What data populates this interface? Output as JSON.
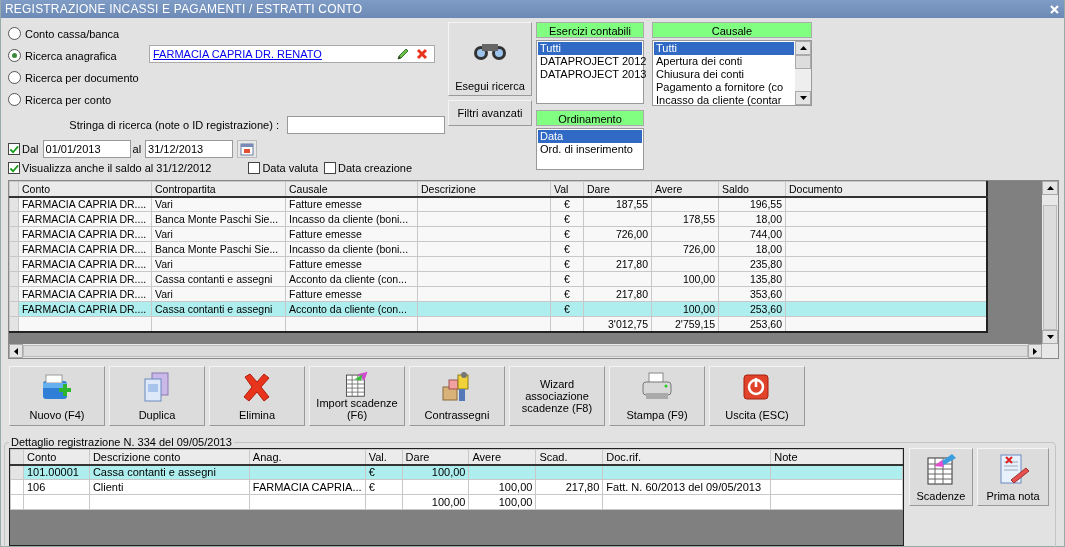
{
  "window": {
    "title": "REGISTRAZIONE INCASSI E PAGAMENTI / ESTRATTI CONTO"
  },
  "search_modes": [
    {
      "label": "Conto cassa/banca",
      "selected": false
    },
    {
      "label": "Ricerca anagrafica",
      "selected": true
    },
    {
      "label": "Ricerca per documento",
      "selected": false
    },
    {
      "label": "Ricerca per conto",
      "selected": false
    }
  ],
  "partner_field": {
    "value": "FARMACIA CAPRIA DR. RENATO"
  },
  "search_string": {
    "label": "Stringa di ricerca (note o ID registrazione) :"
  },
  "date_filter": {
    "checked": true,
    "from_label": "Dal",
    "from": "01/01/2013",
    "to_label": "al",
    "to": "31/12/2013"
  },
  "options": [
    {
      "label": "Visualizza anche il saldo al 31/12/2012",
      "checked": true
    },
    {
      "label": "Data valuta",
      "checked": false
    },
    {
      "label": "Data creazione",
      "checked": false
    }
  ],
  "search_buttons": [
    {
      "label": "Esegui ricerca",
      "kind": "search"
    },
    {
      "label": "Filtri avanzati",
      "kind": "plain"
    }
  ],
  "lists": [
    {
      "title": "Esercizi contabili",
      "items": [
        {
          "label": "Tutti",
          "selected": true
        },
        {
          "label": "DATAPROJECT 2012",
          "selected": false
        },
        {
          "label": "DATAPROJECT 2013",
          "selected": false
        }
      ]
    },
    {
      "title": "Ordinamento",
      "items": [
        {
          "label": "Data",
          "selected": true
        },
        {
          "label": "Ord. di inserimento",
          "selected": false
        }
      ]
    },
    {
      "title": "Causale",
      "items": [
        {
          "label": "Tutti",
          "selected": true
        },
        {
          "label": "Apertura dei conti",
          "selected": false
        },
        {
          "label": "Chiusura dei conti",
          "selected": false
        },
        {
          "label": "Pagamento a fornitore (co",
          "selected": false
        },
        {
          "label": "Incasso da cliente (contar",
          "selected": false
        }
      ]
    }
  ],
  "table": {
    "columns": [
      {
        "label": "Conto",
        "kind": "text"
      },
      {
        "label": "Contropartita",
        "kind": "text"
      },
      {
        "label": "Causale",
        "kind": "text"
      },
      {
        "label": "Descrizione",
        "kind": "text"
      },
      {
        "label": "Val",
        "kind": "currency"
      },
      {
        "label": "Dare",
        "kind": "amount"
      },
      {
        "label": "Avere",
        "kind": "amount"
      },
      {
        "label": "Saldo",
        "kind": "amount"
      },
      {
        "label": "Documento",
        "kind": "text"
      }
    ],
    "rows": [
      {
        "selected": false,
        "cells": [
          "FARMACIA CAPRIA DR....",
          "Vari",
          "Fatture emesse",
          null,
          "€",
          "187,55",
          null,
          "196,55",
          null
        ]
      },
      {
        "selected": false,
        "cells": [
          "FARMACIA CAPRIA DR....",
          "Banca Monte Paschi Sie...",
          "Incasso da cliente (boni...",
          null,
          "€",
          null,
          "178,55",
          "18,00",
          null
        ]
      },
      {
        "selected": false,
        "cells": [
          "FARMACIA CAPRIA DR....",
          "Vari",
          "Fatture emesse",
          null,
          "€",
          "726,00",
          null,
          "744,00",
          null
        ]
      },
      {
        "selected": false,
        "cells": [
          "FARMACIA CAPRIA DR....",
          "Banca Monte Paschi Sie...",
          "Incasso da cliente (boni...",
          null,
          "€",
          null,
          "726,00",
          "18,00",
          null
        ]
      },
      {
        "selected": false,
        "cells": [
          "FARMACIA CAPRIA DR....",
          "Vari",
          "Fatture emesse",
          null,
          "€",
          "217,80",
          null,
          "235,80",
          null
        ]
      },
      {
        "selected": false,
        "cells": [
          "FARMACIA CAPRIA DR....",
          "Cassa contanti e assegni",
          "Acconto da cliente (con...",
          null,
          "€",
          null,
          "100,00",
          "135,80",
          null
        ]
      },
      {
        "selected": false,
        "cells": [
          "FARMACIA CAPRIA DR....",
          "Vari",
          "Fatture emesse",
          null,
          "€",
          "217,80",
          null,
          "353,60",
          null
        ]
      },
      {
        "selected": true,
        "cells": [
          "FARMACIA CAPRIA DR....",
          "Cassa contanti e assegni",
          "Acconto da cliente (con...",
          null,
          "€",
          null,
          "100,00",
          "253,60",
          null
        ]
      },
      {
        "selected": false,
        "cells": [
          null,
          null,
          null,
          null,
          null,
          "3'012,75",
          "2'759,15",
          "253,60",
          null
        ]
      }
    ]
  },
  "actions": [
    {
      "label": "Nuovo (F4)",
      "kind": "new"
    },
    {
      "label": "Duplica",
      "kind": "duplicate"
    },
    {
      "label": "Elimina",
      "kind": "delete"
    },
    {
      "label": "Import scadenze (F6)",
      "kind": "import"
    },
    {
      "label": "Contrassegni",
      "kind": "parcels"
    },
    {
      "label": "Wizard associazione scadenze (F8)",
      "kind": "wizard"
    },
    {
      "label": "Stampa (F9)",
      "kind": "print"
    },
    {
      "label": "Uscita (ESC)",
      "kind": "exit"
    }
  ],
  "detail": {
    "title": "Dettaglio registrazione N. 334 del 09/05/2013",
    "columns": [
      {
        "label": "Conto",
        "kind": "text"
      },
      {
        "label": "Descrizione conto",
        "kind": "text"
      },
      {
        "label": "Anag.",
        "kind": "text"
      },
      {
        "label": "Val.",
        "kind": "text"
      },
      {
        "label": "Dare",
        "kind": "amount"
      },
      {
        "label": "Avere",
        "kind": "amount"
      },
      {
        "label": "Scad.",
        "kind": "amount"
      },
      {
        "label": "Doc.rif.",
        "kind": "text"
      },
      {
        "label": "Note",
        "kind": "text"
      }
    ],
    "rows": [
      {
        "selected": true,
        "cells": [
          "101.00001",
          "Cassa contanti e assegni",
          null,
          "€",
          "100,00",
          null,
          null,
          null,
          null
        ]
      },
      {
        "selected": false,
        "cells": [
          "106",
          "Clienti",
          "FARMACIA CAPRIA...",
          "€",
          null,
          "100,00",
          "217,80",
          "Fatt. N. 60/2013 del 09/05/2013",
          null
        ]
      },
      {
        "selected": false,
        "cells": [
          null,
          null,
          null,
          null,
          "100,00",
          "100,00",
          null,
          null,
          null
        ]
      }
    ],
    "buttons": [
      {
        "label": "Scadenze",
        "kind": "schedule"
      },
      {
        "label": "Prima nota",
        "kind": "journal"
      }
    ]
  }
}
